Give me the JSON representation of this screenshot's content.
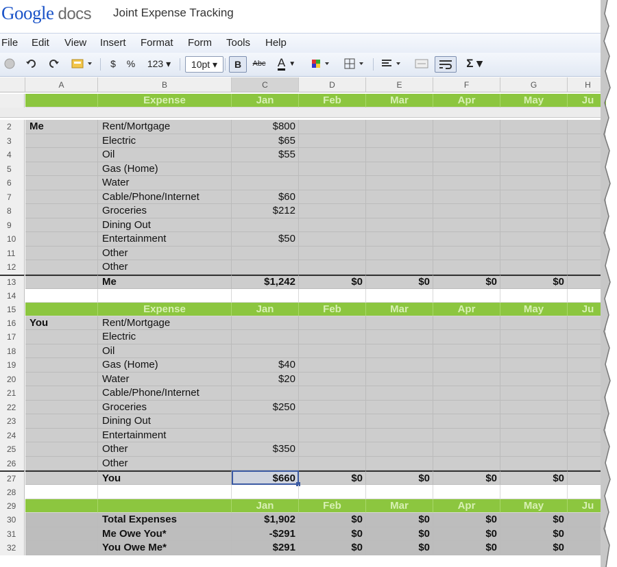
{
  "app": {
    "logo_google": "Google",
    "logo_docs": "docs",
    "doc_title": "Joint Expense Tracking"
  },
  "menu": [
    "File",
    "Edit",
    "View",
    "Insert",
    "Format",
    "Form",
    "Tools",
    "Help"
  ],
  "toolbar": {
    "currency": "$",
    "percent": "%",
    "number_format": "123 ▾",
    "font_size": "10pt ▾",
    "bold": "B",
    "strike": "Abc",
    "text_color": "A",
    "sum": "Σ ▾"
  },
  "columns": [
    "A",
    "B",
    "C",
    "D",
    "E",
    "F",
    "G",
    "H"
  ],
  "months": [
    "Jan",
    "Feb",
    "Mar",
    "Apr",
    "May",
    "Ju"
  ],
  "header_label": "Expense",
  "colors": {
    "accent_green": "#8cc63f",
    "cell_gray": "#cdcdcd",
    "selection": "#3b5aa3"
  },
  "me": {
    "label": "Me",
    "rows": [
      {
        "num": "2",
        "name": "Rent/Mortgage",
        "jan": "$800"
      },
      {
        "num": "3",
        "name": "Electric",
        "jan": "$65"
      },
      {
        "num": "4",
        "name": "Oil",
        "jan": "$55"
      },
      {
        "num": "5",
        "name": "Gas (Home)",
        "jan": ""
      },
      {
        "num": "6",
        "name": "Water",
        "jan": ""
      },
      {
        "num": "7",
        "name": "Cable/Phone/Internet",
        "jan": "$60"
      },
      {
        "num": "8",
        "name": "Groceries",
        "jan": "$212"
      },
      {
        "num": "9",
        "name": "Dining Out",
        "jan": ""
      },
      {
        "num": "10",
        "name": "Entertainment",
        "jan": "$50"
      },
      {
        "num": "11",
        "name": "Other",
        "jan": ""
      },
      {
        "num": "12",
        "name": "Other",
        "jan": ""
      }
    ],
    "total": {
      "num": "13",
      "name": "Me",
      "values": [
        "$1,242",
        "$0",
        "$0",
        "$0",
        "$0"
      ]
    }
  },
  "you": {
    "label": "You",
    "header_num": "15",
    "rows": [
      {
        "num": "16",
        "name": "Rent/Mortgage",
        "jan": ""
      },
      {
        "num": "17",
        "name": "Electric",
        "jan": ""
      },
      {
        "num": "18",
        "name": "Oil",
        "jan": ""
      },
      {
        "num": "19",
        "name": "Gas (Home)",
        "jan": "$40"
      },
      {
        "num": "20",
        "name": "Water",
        "jan": "$20"
      },
      {
        "num": "21",
        "name": "Cable/Phone/Internet",
        "jan": ""
      },
      {
        "num": "22",
        "name": "Groceries",
        "jan": "$250"
      },
      {
        "num": "23",
        "name": "Dining Out",
        "jan": ""
      },
      {
        "num": "24",
        "name": "Entertainment",
        "jan": ""
      },
      {
        "num": "25",
        "name": "Other",
        "jan": "$350"
      },
      {
        "num": "26",
        "name": "Other",
        "jan": ""
      }
    ],
    "total": {
      "num": "27",
      "name": "You",
      "values": [
        "$660",
        "$0",
        "$0",
        "$0",
        "$0"
      ]
    }
  },
  "blank_rows": [
    "14",
    "28"
  ],
  "summary": {
    "header_num": "29",
    "rows": [
      {
        "num": "30",
        "name": "Total Expenses",
        "values": [
          "$1,902",
          "$0",
          "$0",
          "$0",
          "$0"
        ]
      },
      {
        "num": "31",
        "name": "Me Owe You*",
        "values": [
          "-$291",
          "$0",
          "$0",
          "$0",
          "$0"
        ]
      },
      {
        "num": "32",
        "name": "You Owe Me*",
        "values": [
          "$291",
          "$0",
          "$0",
          "$0",
          "$0"
        ]
      }
    ]
  }
}
